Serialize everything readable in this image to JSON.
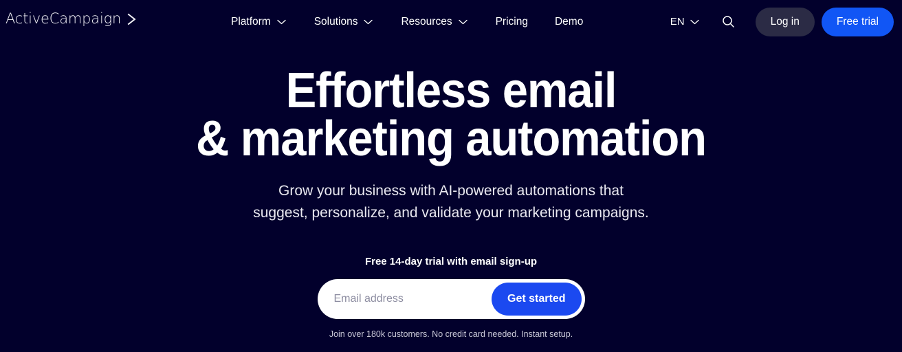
{
  "site": {
    "brand_name": "ActiveCampaign",
    "logo_icon": "chevron-right-mark",
    "background_color": "#02002c",
    "accent_blue": "#1156f5",
    "login_bg": "#2b2b45"
  },
  "header": {
    "nav_items": [
      {
        "label": "Platform",
        "has_dropdown": true,
        "icon": "chevron-down-icon"
      },
      {
        "label": "Solutions",
        "has_dropdown": true,
        "icon": "chevron-down-icon"
      },
      {
        "label": "Resources",
        "has_dropdown": true,
        "icon": "chevron-down-icon"
      },
      {
        "label": "Pricing",
        "has_dropdown": false
      },
      {
        "label": "Demo",
        "has_dropdown": false
      }
    ],
    "language": {
      "label": "EN",
      "icon": "chevron-down-icon"
    },
    "search_icon": "search-icon",
    "login_label": "Log in",
    "trial_label": "Free trial"
  },
  "hero": {
    "headline_line1": "Effortless email",
    "headline_line2": "& marketing automation",
    "subhead_line1": "Grow your business with AI-powered automations that",
    "subhead_line2": "suggest, personalize, and validate your marketing campaigns.",
    "trial_note": "Free 14-day trial with email sign-up",
    "email_placeholder": "Email address",
    "email_value": "",
    "cta_label": "Get started",
    "fineprint": "Join over 180k customers. No credit card needed. Instant setup."
  }
}
